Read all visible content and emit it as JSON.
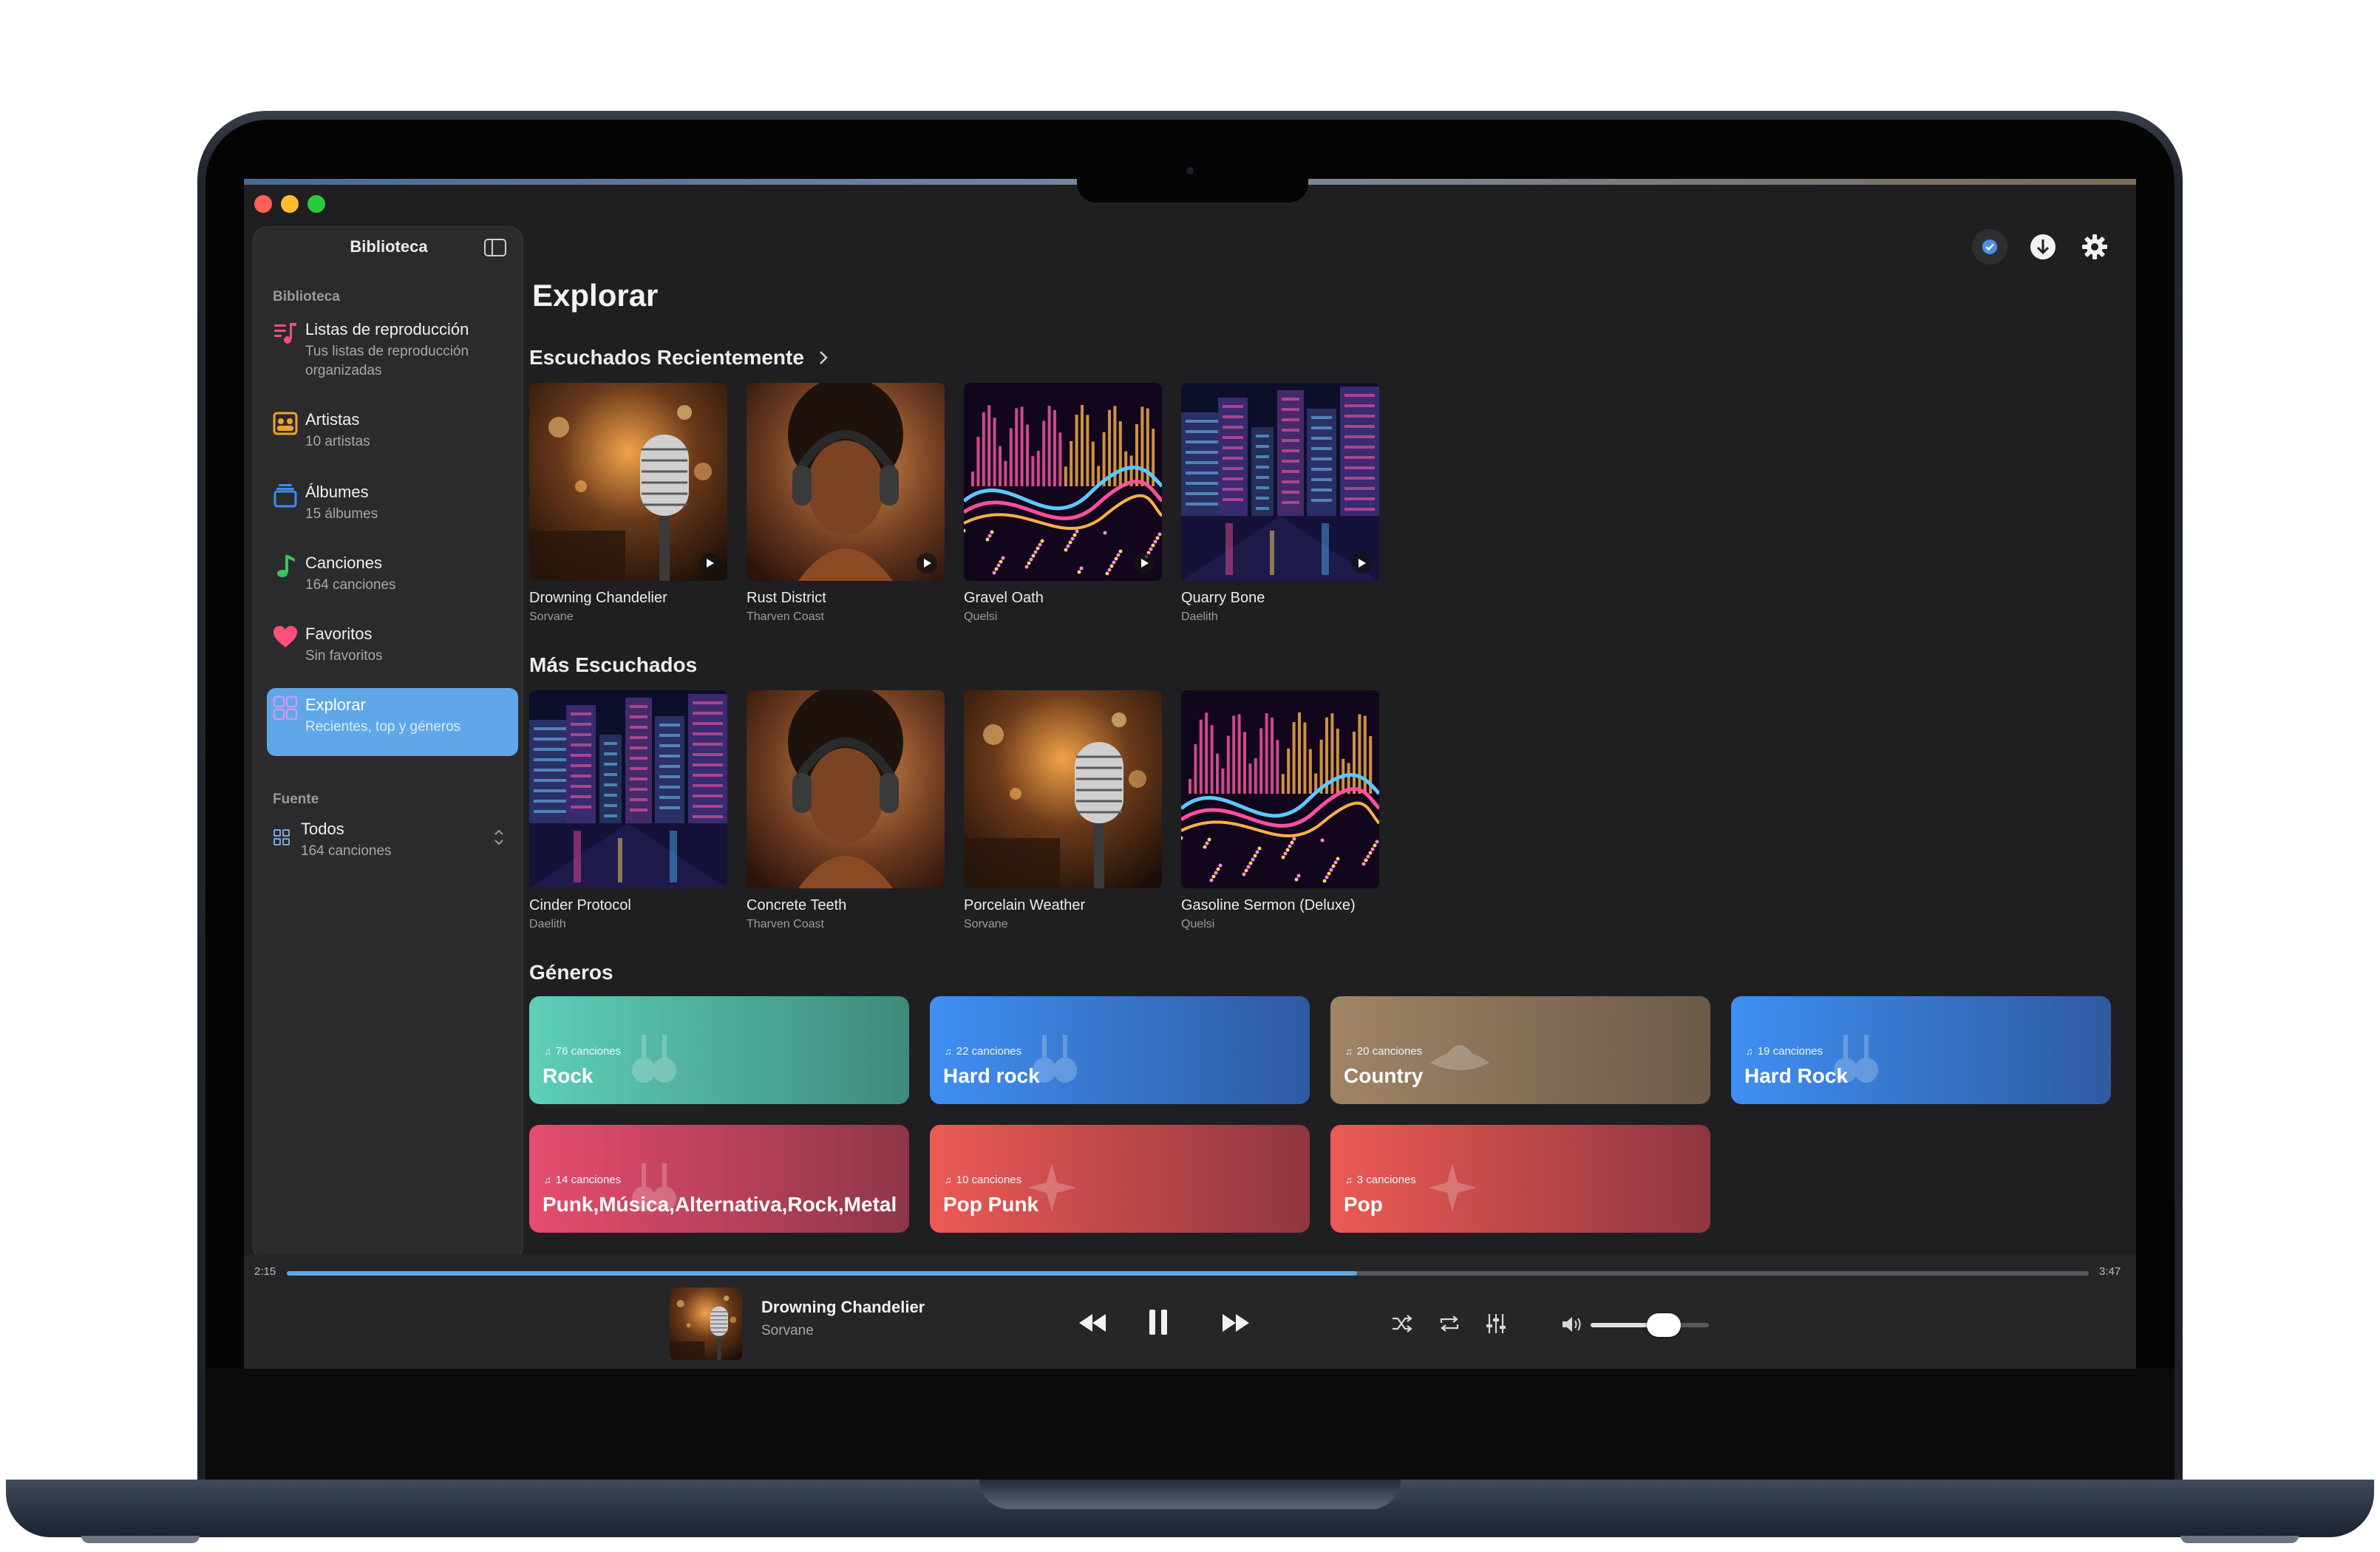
{
  "app": {
    "sidebar_title": "Biblioteca"
  },
  "sidebar": {
    "section_library": "Biblioteca",
    "items": [
      {
        "label": "Listas de reproducción",
        "sub": "Tus listas de reproducción organizadas",
        "icon": "playlist-icon"
      },
      {
        "label": "Artistas",
        "sub": "10 artistas",
        "icon": "artists-icon"
      },
      {
        "label": "Álbumes",
        "sub": "15 álbumes",
        "icon": "albums-icon"
      },
      {
        "label": "Canciones",
        "sub": "164 canciones",
        "icon": "music-note-icon"
      },
      {
        "label": "Favoritos",
        "sub": "Sin favoritos",
        "icon": "heart-icon"
      },
      {
        "label": "Explorar",
        "sub": "Recientes, top y géneros",
        "icon": "grid-icon",
        "active": true
      }
    ],
    "section_source": "Fuente",
    "source": {
      "label": "Todos",
      "sub": "164 canciones"
    }
  },
  "main": {
    "title": "Explorar",
    "recent": {
      "title": "Escuchados Recientemente",
      "items": [
        {
          "title": "Drowning Chandelier",
          "artist": "Sorvane",
          "art": "microphone"
        },
        {
          "title": "Rust District",
          "artist": "Tharven Coast",
          "art": "headphones"
        },
        {
          "title": "Gravel Oath",
          "artist": "Quelsi",
          "art": "waves"
        },
        {
          "title": "Quarry Bone",
          "artist": "Daelith",
          "art": "city"
        }
      ]
    },
    "top": {
      "title": "Más Escuchados",
      "items": [
        {
          "title": "Cinder Protocol",
          "artist": "Daelith",
          "art": "city"
        },
        {
          "title": "Concrete Teeth",
          "artist": "Tharven Coast",
          "art": "headphones"
        },
        {
          "title": "Porcelain Weather",
          "artist": "Sorvane",
          "art": "microphone"
        },
        {
          "title": "Gasoline Sermon (Deluxe)",
          "artist": "Quelsi",
          "art": "waves"
        }
      ]
    },
    "genres": {
      "title": "Géneros",
      "items": [
        {
          "count": "76 canciones",
          "name": "Rock",
          "from": "#5ecfb9",
          "to": "#3f8a7a",
          "icon": "guitars-icon"
        },
        {
          "count": "22 canciones",
          "name": "Hard rock",
          "from": "#3f8ff2",
          "to": "#2e5aa0",
          "icon": "guitars-icon"
        },
        {
          "count": "20 canciones",
          "name": "Country",
          "from": "#a08466",
          "to": "#6b5a48",
          "icon": "hat-icon"
        },
        {
          "count": "19 canciones",
          "name": "Hard Rock",
          "from": "#3f8ff2",
          "to": "#2e5aa0",
          "icon": "guitars-icon"
        },
        {
          "count": "14 canciones",
          "name": "Punk,Música,Alternativa,Rock,Metal",
          "from": "#e64d6e",
          "to": "#8e3648",
          "icon": "guitars-icon"
        },
        {
          "count": "10 canciones",
          "name": "Pop Punk",
          "from": "#ec5a55",
          "to": "#8e3640",
          "icon": "sparkle-icon"
        },
        {
          "count": "3 canciones",
          "name": "Pop",
          "from": "#ec5a55",
          "to": "#8e3640",
          "icon": "sparkle-icon"
        }
      ]
    }
  },
  "player": {
    "elapsed": "2:15",
    "duration": "3:47",
    "progress": 0.594,
    "title": "Drowning Chandelier",
    "artist": "Sorvane",
    "volume": 0.62
  },
  "colors": {
    "accent": "#5fa7e8",
    "background": "#1f1f21",
    "sidebar": "#2b2b2d"
  }
}
